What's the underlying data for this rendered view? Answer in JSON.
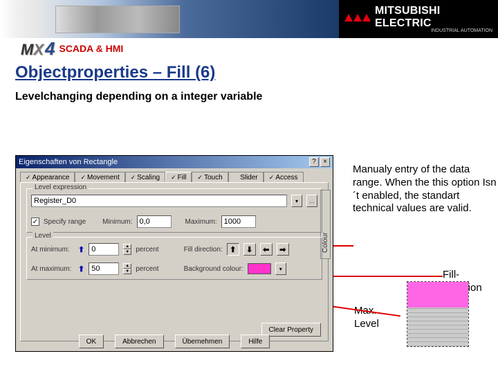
{
  "brand": {
    "name": "MITSUBISHI ELECTRIC",
    "sub": "INDUSTRIAL AUTOMATION"
  },
  "product": {
    "mx": "MX",
    "four": "4",
    "scada": "SCADA & HMI"
  },
  "title": "Objectproperties – Fill (6)",
  "subtitle": "Levelchanging depending on a integer variable",
  "dialog": {
    "caption": "Eigenschaften von Rectangle",
    "tabs": [
      "Appearance",
      "Movement",
      "Scaling",
      "Fill",
      "Touch",
      "Slider",
      "Access"
    ],
    "tab_checks": [
      true,
      true,
      true,
      true,
      true,
      false,
      true
    ],
    "active_tab": "Fill",
    "side": "Colour",
    "group_level_expr": "Level expression",
    "register": "Register_D0",
    "chk_specify": "Specify range",
    "lbl_min": "Minimum:",
    "val_min": "0,0",
    "lbl_max": "Maximum:",
    "val_max": "1000",
    "group_level": "Level",
    "at_min": "At minimum:",
    "at_min_val": "0",
    "pct": "percent",
    "at_max": "At maximum:",
    "at_max_val": "50",
    "fill_dir": "Fill direction:",
    "bg_col": "Background colour:",
    "clear": "Clear Property",
    "btns": [
      "OK",
      "Abbrechen",
      "Übernehmen",
      "Hilfe"
    ]
  },
  "annot": {
    "a1": "Manualy entry of the data range. When the this option Isn´t enabled, the standart technical values are valid.",
    "a2": "Fill-direction",
    "a3": "Max. Level"
  }
}
